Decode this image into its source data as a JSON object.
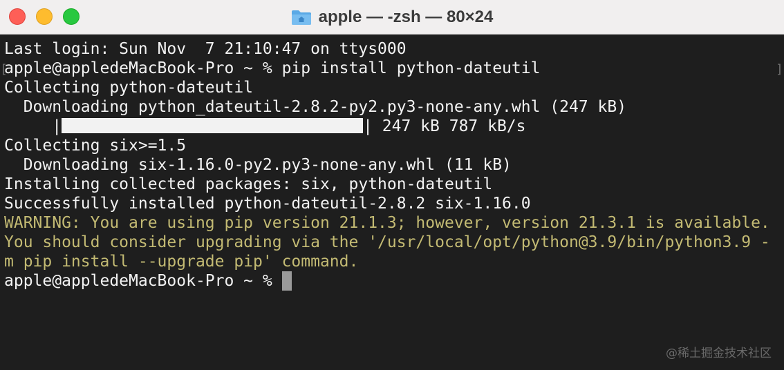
{
  "window": {
    "title": "apple — -zsh — 80×24",
    "folder_icon": "folder-icon"
  },
  "colors": {
    "close": "#fe5f57",
    "minimize": "#febc2e",
    "zoom": "#28c840",
    "background": "#1e1e1e",
    "text": "#f2f2f2",
    "warning": "#c3ba73"
  },
  "terminal": {
    "lines": {
      "last_login": "Last login: Sun Nov  7 21:10:47 on ttys000",
      "prompt_command": "apple@appledeMacBook-Pro ~ % pip install python-dateutil",
      "collecting_dateutil": "Collecting python-dateutil",
      "downloading_dateutil": "  Downloading python_dateutil-2.8.2-py2.py3-none-any.whl (247 kB)",
      "progress_prefix": "     |",
      "progress_suffix": "| 247 kB 787 kB/s",
      "collecting_six": "Collecting six>=1.5",
      "downloading_six": "  Downloading six-1.16.0-py2.py3-none-any.whl (11 kB)",
      "installing": "Installing collected packages: six, python-dateutil",
      "success": "Successfully installed python-dateutil-2.8.2 six-1.16.0",
      "warning_1": "WARNING: You are using pip version 21.1.3; however, version 21.3.1 is available.",
      "warning_2": "You should consider upgrading via the '/usr/local/opt/python@3.9/bin/python3.9 -",
      "warning_3": "m pip install --upgrade pip' command.",
      "final_prompt": "apple@appledeMacBook-Pro ~ % "
    },
    "progress": 1.0,
    "bracket_left": "[",
    "bracket_right": "]"
  },
  "watermark": "@稀土掘金技术社区"
}
